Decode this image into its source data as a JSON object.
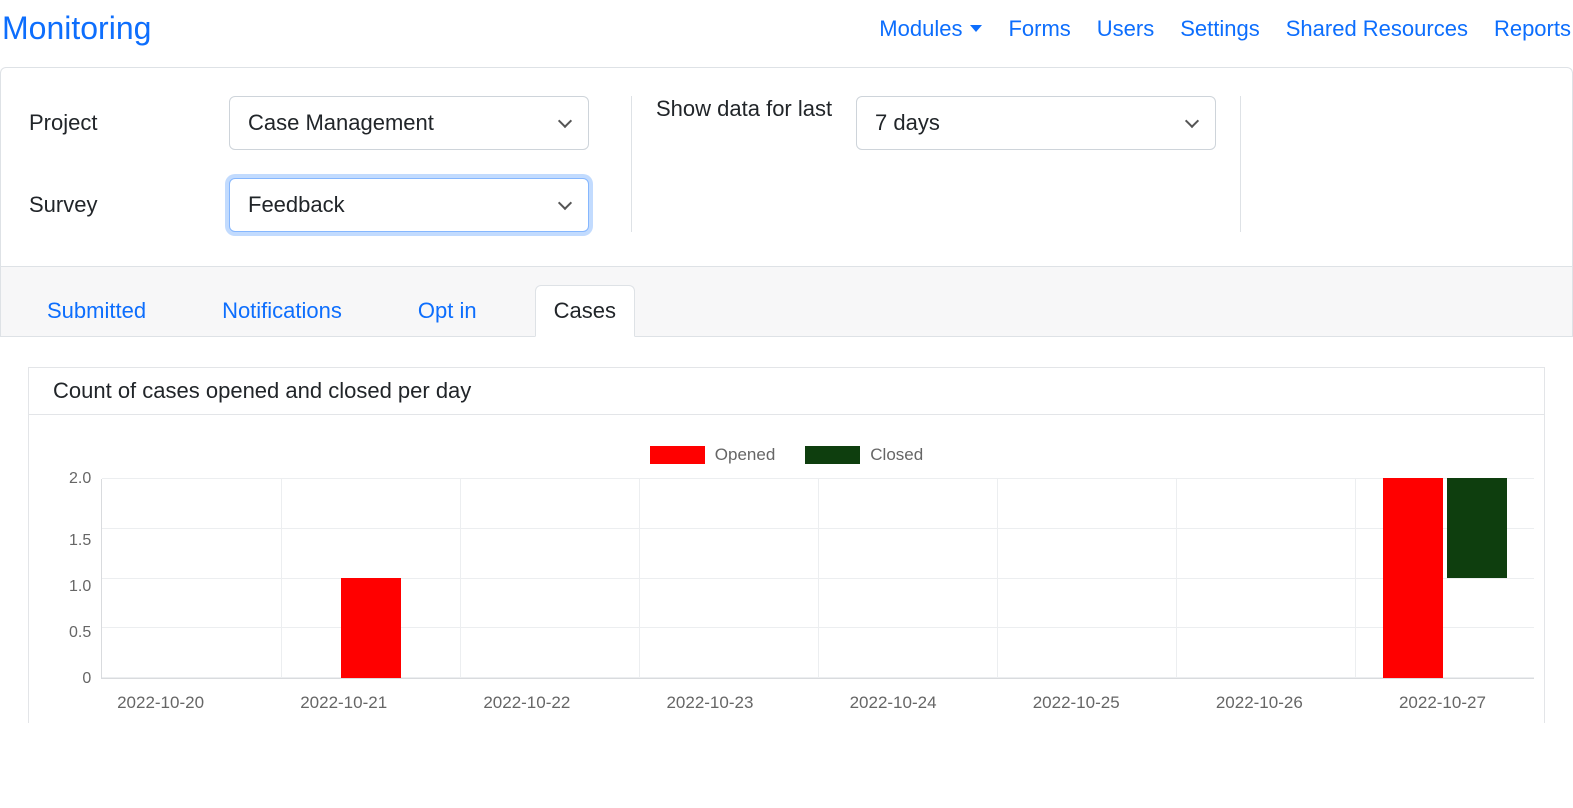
{
  "header": {
    "title": "Monitoring",
    "nav": [
      "Modules",
      "Forms",
      "Users",
      "Settings",
      "Shared Resources",
      "Reports"
    ]
  },
  "filters": {
    "project_label": "Project",
    "project_value": "Case Management",
    "survey_label": "Survey",
    "survey_value": "Feedback",
    "range_label": "Show data for last",
    "range_value": "7 days"
  },
  "tabs": [
    "Submitted",
    "Notifications",
    "Opt in",
    "Cases"
  ],
  "active_tab": "Cases",
  "chart_title": "Count of cases opened and closed per day",
  "legend": {
    "opened": "Opened",
    "closed": "Closed"
  },
  "chart_data": {
    "type": "bar",
    "title": "Count of cases opened and closed per day",
    "xlabel": "",
    "ylabel": "",
    "ylim": [
      0,
      2
    ],
    "y_ticks": [
      2.0,
      1.5,
      1.0,
      0.5,
      0
    ],
    "categories": [
      "2022-10-20",
      "2022-10-21",
      "2022-10-22",
      "2022-10-23",
      "2022-10-24",
      "2022-10-25",
      "2022-10-26",
      "2022-10-27"
    ],
    "series": [
      {
        "name": "Opened",
        "color": "#ff0000",
        "values": [
          0,
          1,
          0,
          0,
          0,
          0,
          0,
          2
        ]
      },
      {
        "name": "Closed",
        "color": "#0e3e0e",
        "values": [
          0,
          0,
          0,
          0,
          0,
          0,
          0,
          1
        ]
      }
    ]
  }
}
